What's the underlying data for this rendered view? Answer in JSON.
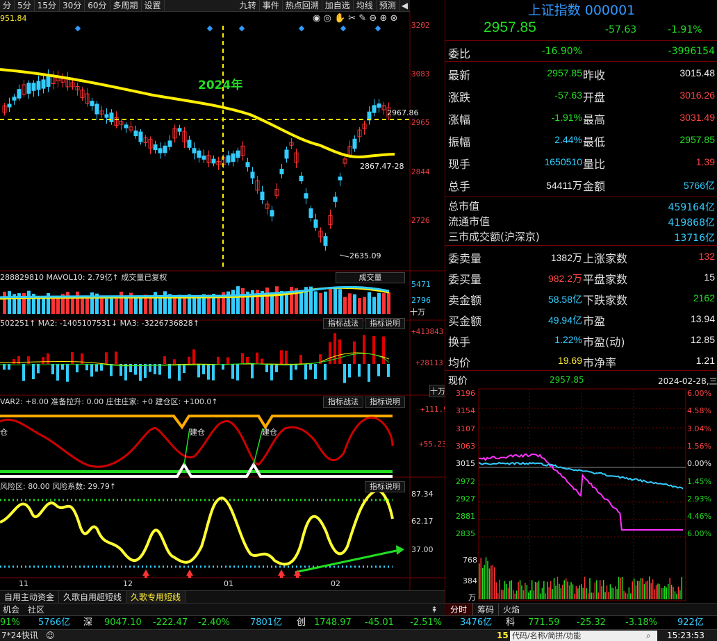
{
  "toolbar": {
    "periods": [
      "分",
      "5分",
      "15分",
      "30分",
      "60分",
      "多周期",
      "设置"
    ],
    "actions": [
      "九转",
      "事件",
      "热点回溯",
      "加自选",
      "均线",
      "预测"
    ]
  },
  "main_chart": {
    "hi_label": "951.84",
    "price_ticks": [
      "3202",
      "3083",
      "2965",
      "2844",
      "2726"
    ],
    "year_label": "2024年",
    "cursor_price": "2967.86",
    "ma_label": "2867.47-28",
    "low_label": "2635.09"
  },
  "volume_panel": {
    "header": "288829810  MAVOL10: 2.79亿↑  成交量已复权",
    "button": "成交量",
    "ticks": [
      "5471",
      "2796",
      "十万"
    ]
  },
  "macd_panel": {
    "header": "502251↑ MA2: -1405107531↓ MA3: -3226736828↑",
    "btn1": "指标战法",
    "btn2": "指标说明",
    "ticks": [
      "+413843",
      "+28113",
      "十万"
    ]
  },
  "var_panel": {
    "header": "VAR2: +8.00  准备拉升: 0.00  庄住庄家: +0  建仓区: +100.0↑",
    "btn1": "指标战法",
    "btn2": "指标说明",
    "ticks": [
      "+111.9",
      "+55.23"
    ],
    "marks": [
      "建仓",
      "建仓"
    ],
    "left_mark": "仓"
  },
  "risk_panel": {
    "header": "风险区: 80.00  风险系数: 29.79↑",
    "btn": "指标说明",
    "ticks": [
      "87.34",
      "62.17",
      "37.00"
    ]
  },
  "x_axis": [
    "11",
    "12",
    "01",
    "02"
  ],
  "bottom_tabs": [
    "自用主动资金",
    "久歌自用超短线",
    "久歌专用短线"
  ],
  "quote": {
    "title": "上证指数 000001",
    "price": "2957.85",
    "change": "-57.63",
    "pct": "-1.91%",
    "weibi_label": "委比",
    "weibi_pct": "-16.90%",
    "weibi_val": "-3996154",
    "rows": [
      {
        "l1": "最新",
        "v1": "2957.85",
        "l2": "昨收",
        "v2": "3015.48",
        "c1": "g",
        "c2": "w"
      },
      {
        "l1": "涨跌",
        "v1": "-57.63",
        "l2": "开盘",
        "v2": "3016.26",
        "c1": "g",
        "c2": "r"
      },
      {
        "l1": "涨幅",
        "v1": "-1.91%",
        "l2": "最高",
        "v2": "3031.49",
        "c1": "g",
        "c2": "r"
      },
      {
        "l1": "振幅",
        "v1": "2.44%",
        "l2": "最低",
        "v2": "2957.85",
        "c1": "c",
        "c2": "g"
      },
      {
        "l1": "现手",
        "v1": "1650510",
        "l2": "量比",
        "v2": "1.39",
        "c1": "c",
        "c2": "r"
      },
      {
        "l1": "总手",
        "v1": "54411万",
        "l2": "金额",
        "v2": "5766亿",
        "c1": "w",
        "c2": "c"
      }
    ],
    "mkt": [
      {
        "l": "总市值",
        "v": "459164亿"
      },
      {
        "l": "流通市值",
        "v": "419868亿"
      },
      {
        "l": "三市成交额(沪深京)",
        "v": "13716亿"
      }
    ],
    "rows2": [
      {
        "l1": "委卖量",
        "v1": "1382万",
        "l2": "上涨家数",
        "v2": "132",
        "c1": "w",
        "c2": "r"
      },
      {
        "l1": "委买量",
        "v1": "982.2万",
        "l2": "平盘家数",
        "v2": "15",
        "c1": "r",
        "c2": "w"
      },
      {
        "l1": "卖金额",
        "v1": "58.58亿",
        "l2": "下跌家数",
        "v2": "2162",
        "c1": "c",
        "c2": "g"
      },
      {
        "l1": "买金额",
        "v1": "49.94亿",
        "l2": "市盈",
        "v2": "13.94",
        "c1": "c",
        "c2": "w"
      },
      {
        "l1": "换手",
        "v1": "1.22%",
        "l2": "市盈(动)",
        "v2": "12.85",
        "c1": "c",
        "c2": "w"
      },
      {
        "l1": "均价",
        "v1": "19.69",
        "l2": "市净率",
        "v2": "1.21",
        "c1": "y",
        "c2": "w"
      }
    ]
  },
  "intraday": {
    "label": "现价",
    "price": "2957.85",
    "date": "2024-02-28,三",
    "left_ticks": [
      "3196",
      "3154",
      "3107",
      "3063",
      "3015",
      "2972",
      "2927",
      "2881",
      "2835"
    ],
    "right_ticks": [
      "6.00%",
      "4.58%",
      "3.04%",
      "1.56%",
      "0.00%",
      "1.45%",
      "2.93%",
      "4.46%",
      "6.00%"
    ],
    "vol_ticks": [
      "768",
      "384",
      "万"
    ],
    "tabs": [
      "分时",
      "筹码",
      "火焰"
    ],
    "tab_icon": "15"
  },
  "ticker": {
    "items": [
      {
        "name": "",
        "a": "91%",
        "b": "5766亿"
      },
      {
        "name": "深",
        "a": "9047.10",
        "b": "-222.47",
        "c": "-2.40%",
        "d": "7801亿"
      },
      {
        "name": "创",
        "a": "1748.97",
        "b": "-45.01",
        "c": "-2.51%",
        "d": "3476亿"
      },
      {
        "name": "科",
        "a": "771.59",
        "b": "-25.32",
        "c": "-3.18%",
        "d": "922亿"
      }
    ]
  },
  "status": {
    "left": "7*24快讯",
    "search_placeholder": "代码/名称/简拼/功能",
    "time": "15:23:53",
    "bottom_left_tabs": [
      "机会",
      "社区"
    ]
  },
  "colors": {
    "up": "#ff4444",
    "down": "#22dd22",
    "ma": "#ffee00",
    "cyan": "#33ccff",
    "panel_border": "#770000"
  }
}
